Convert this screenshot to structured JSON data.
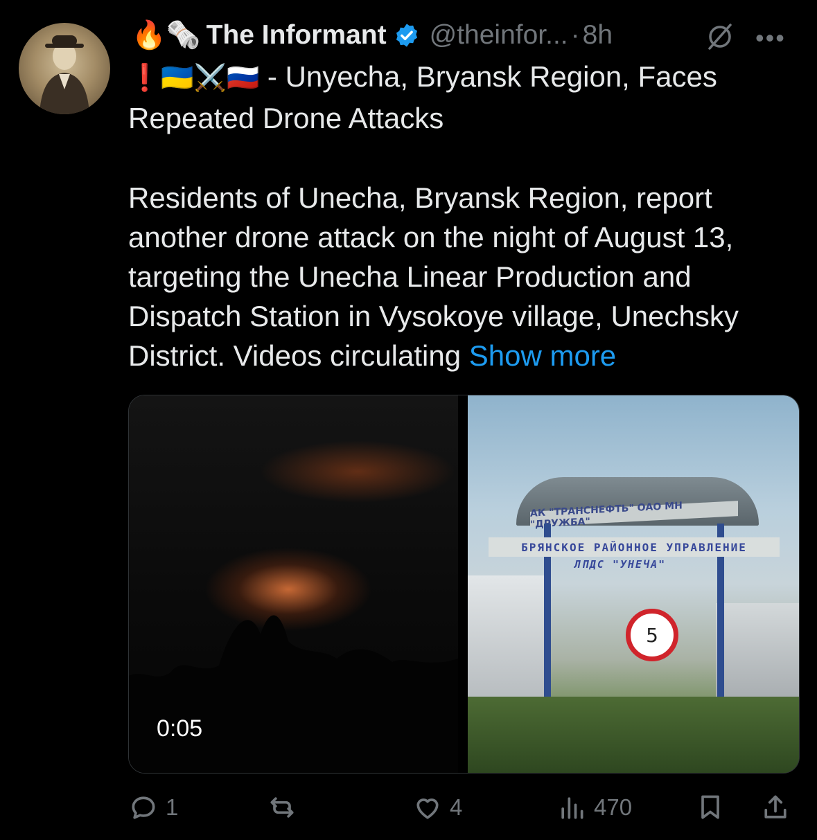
{
  "tweet": {
    "author": {
      "emoji_prefix": "🔥🗞️",
      "display_name": "The Informant",
      "handle": "@theinfor...",
      "verified": true,
      "avatar_icon": "avatar-photo"
    },
    "separator": "·",
    "time": "8h",
    "icons": {
      "grok": "grok-icon",
      "more": "more-icon"
    },
    "more_label": "•••",
    "flags_prefix": "❗🇺🇦⚔️🇷🇺",
    "headline_text": " - Unyecha, Bryansk Region, Faces Repeated Drone Attacks",
    "body_text": "Residents of Unecha, Bryansk Region, report another drone attack on the night of August 13, targeting the Unecha Linear Production and Dispatch Station in Vysokoye village, Unechsky District. Videos circulating ",
    "show_more": "Show more",
    "media": {
      "video_duration": "0:05",
      "photo_signs": {
        "top": "АК \"ТРАНСНЕФТЬ\" ОАО МН \"ДРУЖБА\"",
        "middle": "БРЯНСКОЕ РАЙОННОЕ УПРАВЛЕНИЕ",
        "bottom": "ЛПДС \"УНЕЧА\"",
        "speed_limit": "5"
      }
    },
    "actions": {
      "replies": "1",
      "retweets": "",
      "likes": "4",
      "views": "470"
    }
  },
  "colors": {
    "background": "#000000",
    "text": "#e7e9ea",
    "muted": "#71767b",
    "accent": "#1d9bf0"
  }
}
